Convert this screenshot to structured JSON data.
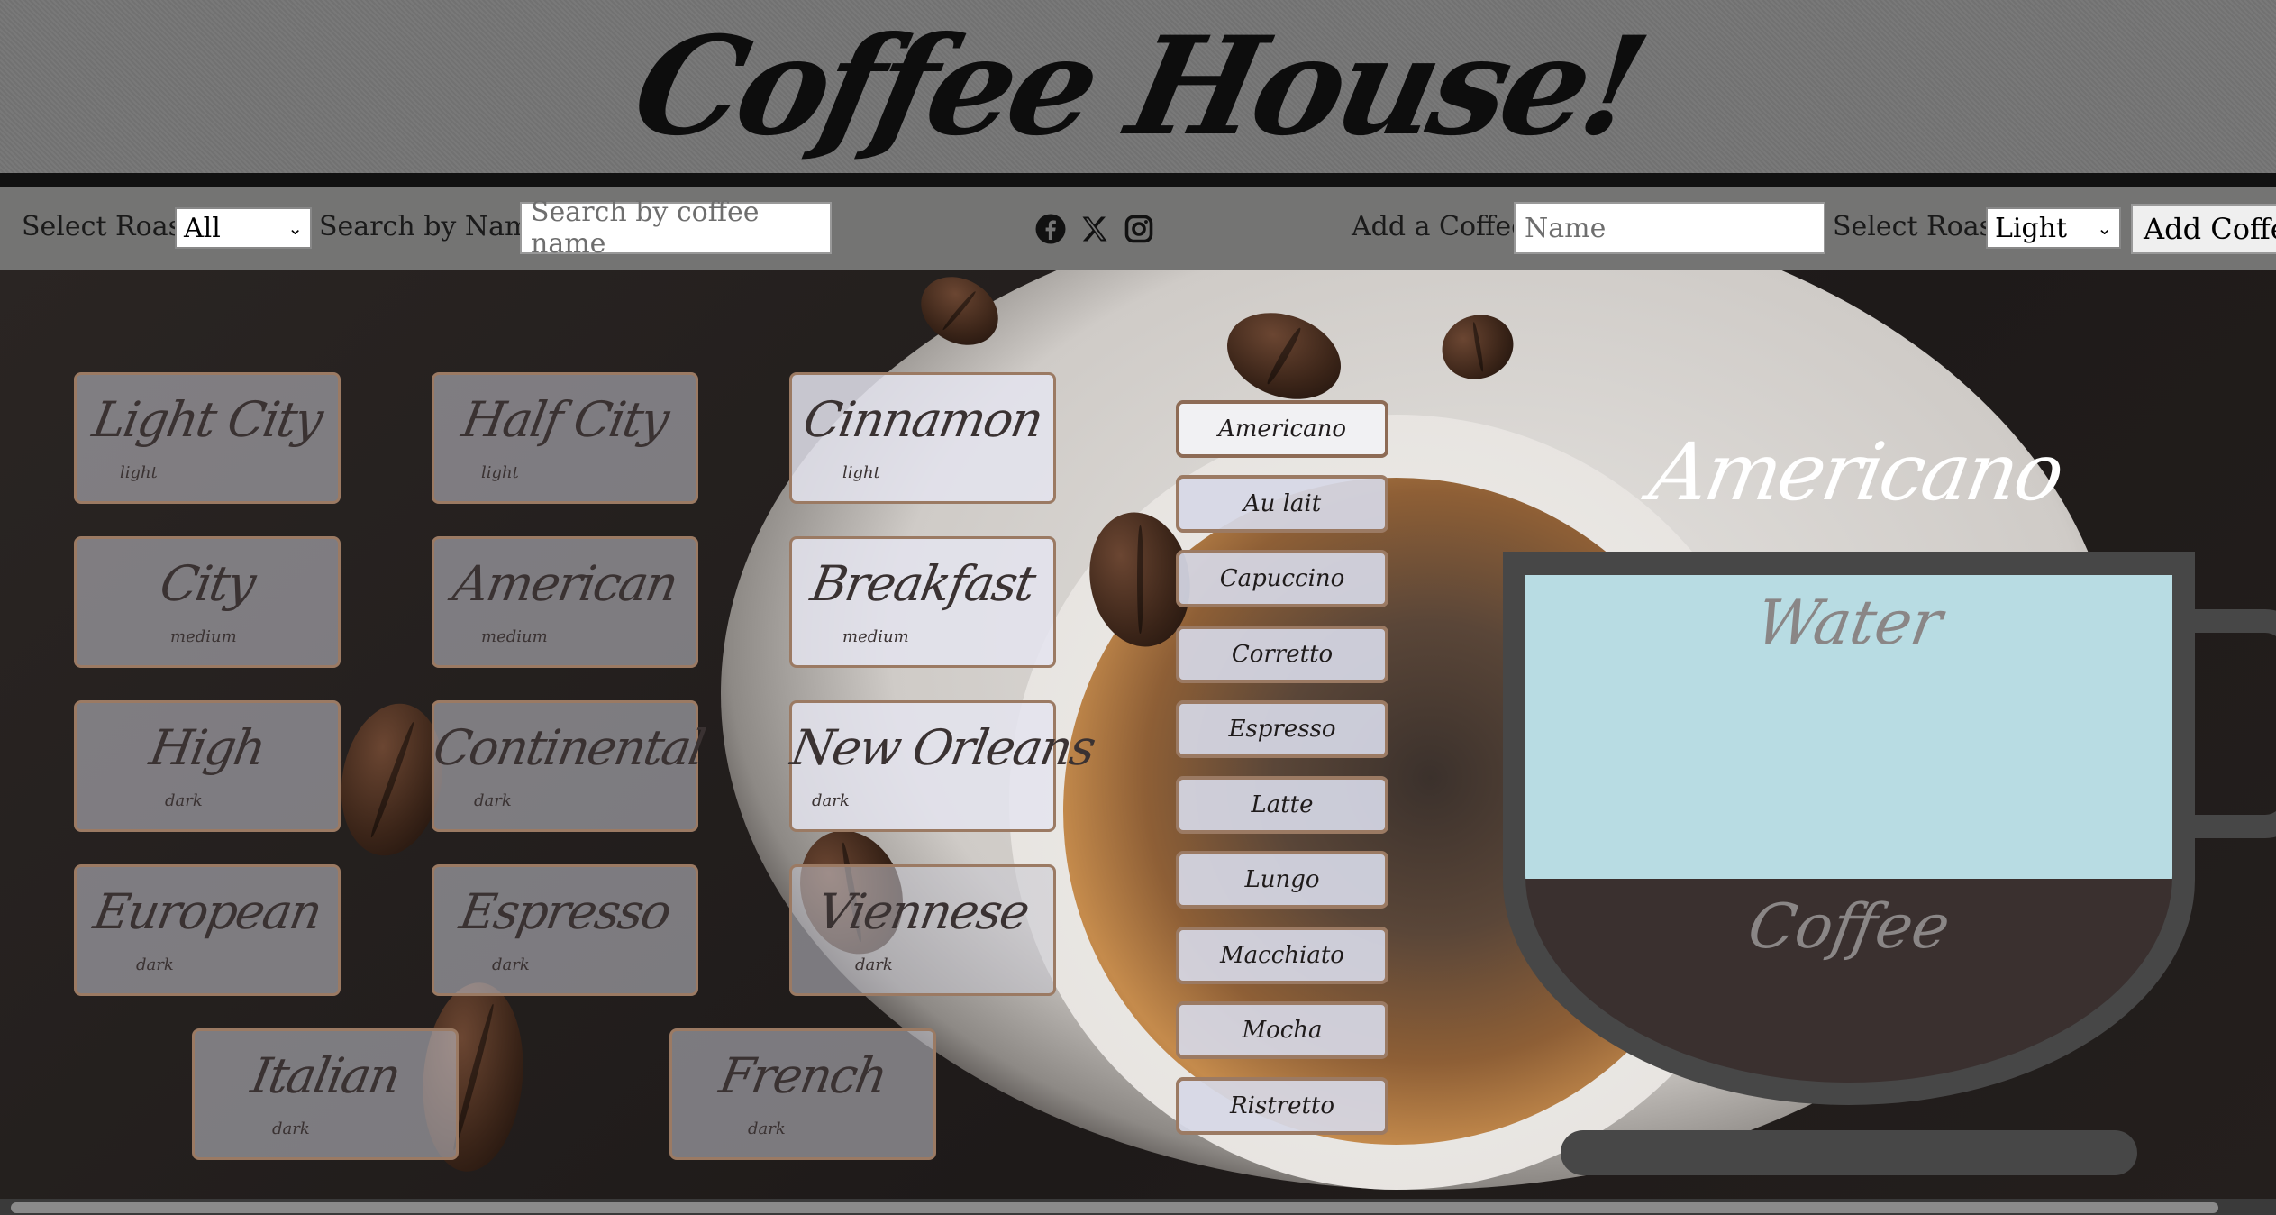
{
  "header": {
    "title": "Coffee House!"
  },
  "toolbar": {
    "filter_roast_label": "Select Roast:",
    "filter_roast_value": "All",
    "search_label": "Search by Name:",
    "search_placeholder": "Search by coffee name",
    "add_label": "Add a Coffee!",
    "add_name_placeholder": "Name",
    "add_roast_label": "Select Roast:",
    "add_roast_value": "Light",
    "add_button": "Add Coffee"
  },
  "social": [
    "facebook-icon",
    "x-icon",
    "instagram-icon"
  ],
  "coffees": [
    {
      "name": "Light City",
      "roast": "light"
    },
    {
      "name": "Half City",
      "roast": "light"
    },
    {
      "name": "Cinnamon",
      "roast": "light"
    },
    {
      "name": "City",
      "roast": "medium"
    },
    {
      "name": "American",
      "roast": "medium"
    },
    {
      "name": "Breakfast",
      "roast": "medium"
    },
    {
      "name": "High",
      "roast": "dark"
    },
    {
      "name": "Continental",
      "roast": "dark"
    },
    {
      "name": "New Orleans",
      "roast": "dark"
    },
    {
      "name": "European",
      "roast": "dark"
    },
    {
      "name": "Espresso",
      "roast": "dark"
    },
    {
      "name": "Viennese",
      "roast": "dark"
    },
    {
      "name": "Italian",
      "roast": "dark"
    },
    {
      "name": "French",
      "roast": "dark"
    }
  ],
  "drinks": [
    "Americano",
    "Au lait",
    "Capuccino",
    "Corretto",
    "Espresso",
    "Latte",
    "Lungo",
    "Macchiato",
    "Mocha",
    "Ristretto"
  ],
  "selected_drink": "Americano",
  "recipe": {
    "title": "Americano",
    "layers": [
      {
        "label": "Water",
        "fraction": 0.6,
        "color": "#b8dce3"
      },
      {
        "label": "Coffee",
        "fraction": 0.4,
        "color": "#3a302f"
      }
    ]
  },
  "colors": {
    "header_bg": "#757575",
    "card_border": "#9b7a63",
    "cup": "#474747"
  }
}
